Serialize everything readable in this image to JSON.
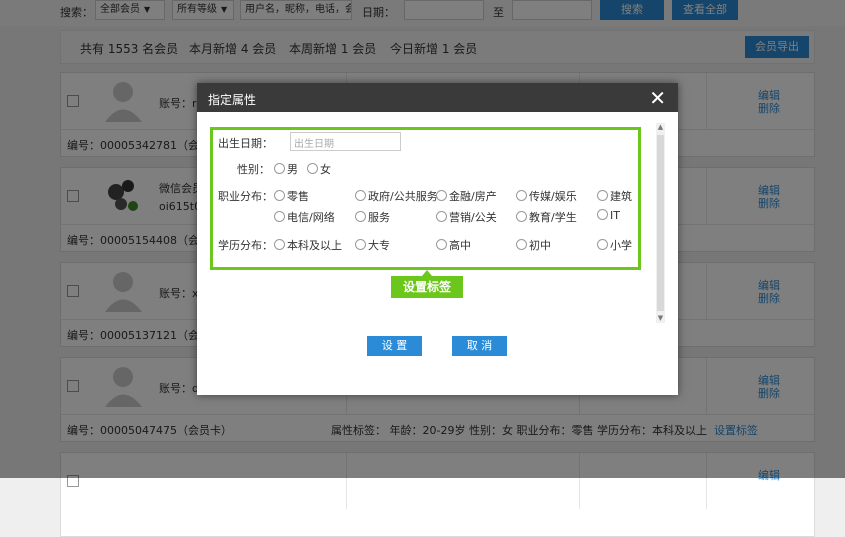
{
  "search": {
    "label": "搜索：",
    "member_type": "全部会员",
    "level": "所有等级",
    "keyword_placeholder": "用户名，昵称，电话，会",
    "date_label": "日期：",
    "to_label": "至",
    "search_btn": "搜索",
    "view_all_btn": "查看全部"
  },
  "stats": {
    "total": "共有 1553 名会员",
    "month_new": "本月新增 4 会员",
    "week_new": "本周新增 1 会员",
    "today_new": "今日新增 1 会员",
    "export_btn": "会员导出"
  },
  "cards": [
    {
      "account": "账号：rw",
      "account2": "",
      "number": "编号：00005342781（会员卡）",
      "edit": "编辑",
      "delete": "删除",
      "tags": ""
    },
    {
      "account": "微信会员",
      "account2": "oi615t0",
      "number": "编号：00005154408（会员卡）",
      "edit": "编辑",
      "delete": "删除",
      "tags": ""
    },
    {
      "account": "账号：xia",
      "account2": "",
      "number": "编号：00005137121（会员卡）",
      "edit": "编辑",
      "delete": "删除",
      "tags": ""
    },
    {
      "account": "账号：ds",
      "account2": "",
      "number": "编号：00005047475（会员卡）",
      "edit": "编辑",
      "delete": "删除",
      "tags": "属性标签：  年龄：20-29岁   性别：女   职业分布：零售   学历分布：本科及以上",
      "tag_link": "设置标签"
    },
    {
      "account": "",
      "account2": "",
      "number": "",
      "edit": "编辑",
      "delete": "",
      "tags": ""
    }
  ],
  "modal": {
    "title": "指定属性",
    "close": "✕",
    "birth_label": "出生日期：",
    "birth_placeholder": "出生日期",
    "gender_label": "性别：",
    "gender_options": [
      "男",
      "女"
    ],
    "job_label": "职业分布：",
    "job_options": [
      "零售",
      "政府/公共服务",
      "金融/房产",
      "传媒/娱乐",
      "建筑",
      "电信/网络",
      "服务",
      "营销/公关",
      "教育/学生",
      "IT"
    ],
    "edu_label": "学历分布：",
    "edu_options": [
      "本科及以上",
      "大专",
      "高中",
      "初中",
      "小学"
    ],
    "callout": "设置标签",
    "confirm_btn": "设 置",
    "cancel_btn": "取 消"
  },
  "colors": {
    "accent_blue": "#2b8bd6",
    "highlight_green": "#6cc71c",
    "modal_header": "#3a3a3a"
  }
}
